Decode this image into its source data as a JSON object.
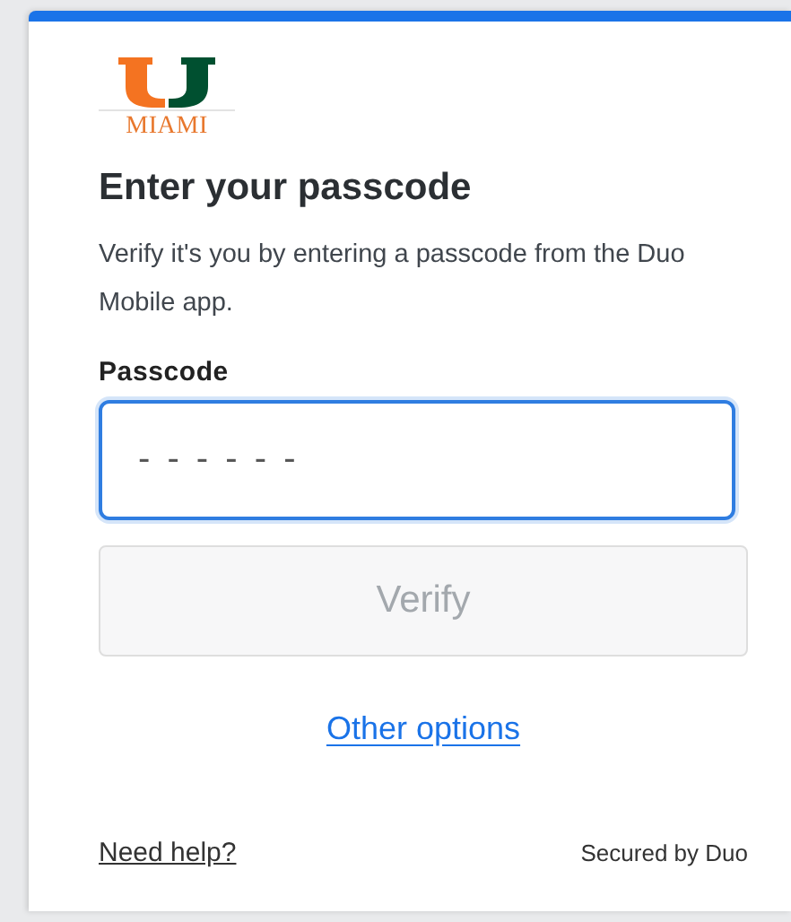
{
  "logo": {
    "text": "MIAMI"
  },
  "heading": "Enter your passcode",
  "description": "Verify it's you by entering a passcode from the Duo Mobile app.",
  "passcode_field": {
    "label": "Passcode",
    "placeholder": "- - - - - -",
    "focused": true
  },
  "verify_button": {
    "label": "Verify",
    "disabled": true
  },
  "other_options_link": "Other options",
  "footer": {
    "help_link": "Need help?",
    "secured_by": "Secured by Duo"
  }
}
